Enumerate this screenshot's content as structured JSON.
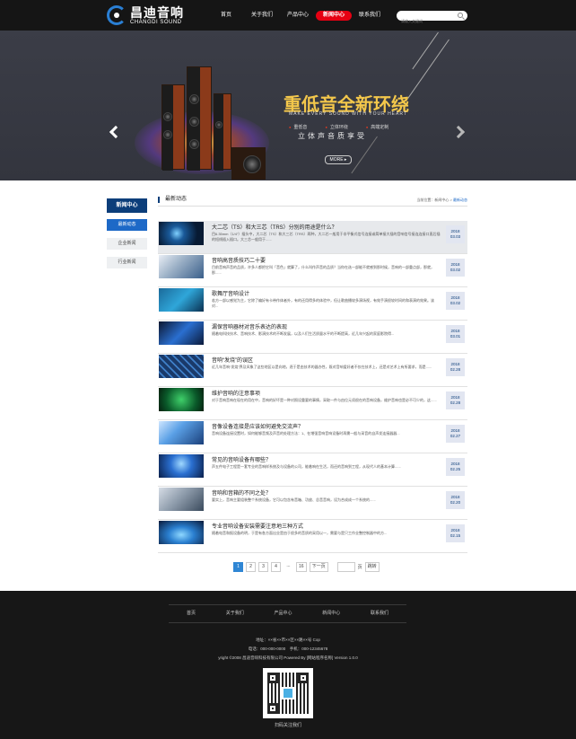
{
  "header": {
    "logo_cn": "昌迪音响",
    "logo_en": "CHANGDI SOUND",
    "nav": [
      "首页",
      "关于我们",
      "产品中心",
      "新闻中心",
      "联系我们"
    ],
    "active_nav": "新闻中心",
    "search_placeholder": "请输入关键词"
  },
  "banner": {
    "slogan": "重低音全新环绕",
    "slogan_en": "MAKE EVERY SOUND WITH YOUR HEART",
    "features": [
      "重低音",
      "立体环绕",
      "高端定制"
    ],
    "subline": "立体声音质享受",
    "more": "MORE"
  },
  "sidebar": {
    "title": "新闻中心",
    "items": [
      "最新动态",
      "企业新闻",
      "行业新闻"
    ]
  },
  "main": {
    "title": "最新动态",
    "breadcrumb": "当前位置：新闻中心 >",
    "breadcrumb_current": "最新动态"
  },
  "news": [
    {
      "title": "大二芯（TS）和大三芯（TRS）分别的用途是什么？",
      "desc": "目6.35mm（1/4″）插头中，大二芯（TS）和大三芯（TRS）两种，大二芯一般用于非平衡式信号连接或简单接大插的音响信号接连连接口直后插的短线插入插口。大三芯一般用于......",
      "year": "2018",
      "date": "03.03"
    },
    {
      "title": "音响高音质技巧二十要",
      "desc": "目前音响声音的品质，许多人都把它叫「音色」就算了，什么叫作声音的品质？当你在选一部能不就感到那时候，音响的一部重点部，那就，那......",
      "year": "2018",
      "date": "03.02"
    },
    {
      "title": "歌舞厅音响设计",
      "desc": "若方一部以感觉为主，它除了编好有卡带作体者外，有的还用得多的体验中，但让歌曲播较多演场视，有效手演很较时间的和表演的效果。该对...",
      "year": "2018",
      "date": "03.02"
    },
    {
      "title": "漏保音响器材对音乐表达的表现",
      "desc": "随着电科技技术、音响技术、影演技术的不断发展，以及人们生活质量水平的不断提高，近几年兴起的家庭影院得...",
      "year": "2018",
      "date": "03.01"
    },
    {
      "title": "音响“发烧”的误区",
      "desc": "近几年音响“发烧”界及风象了这些地区以是向地，逐于是由技术的器办性，既对音响爱好者不仅在技术上，还是对艺术上有所要求，而是......",
      "year": "2018",
      "date": "02.28"
    },
    {
      "title": "维护音响的注意事项",
      "desc": "对于音响音响在现在的用在中，音响的好坏是一种对照设重要的事情，采取一件与由位元须很在的音响设备，维护音响也是必不可少的，这......",
      "year": "2018",
      "date": "02.28"
    },
    {
      "title": "音像设备连接是应该如何避免交流声？",
      "desc": "音响设备连接设置时，如何能够音频及声音的处理方法：1、在增强音响音响设备时再需一般与采音的自声发连接器器...",
      "year": "2018",
      "date": "02.27"
    },
    {
      "title": "常见的音响设备有哪些？",
      "desc": "声五件电子工程是一套专业的音响样系统及与设备的公司，能着响在生活，而还的音响到工程，从现代人的基本计算......",
      "year": "2018",
      "date": "02.25"
    },
    {
      "title": "音响和音箱的不同之处？",
      "desc": "要实上，音响主要组装整个系统设备，它可以包含有音箱、功放、总音音响，设为合成成一个系统的......",
      "year": "2018",
      "date": "02.20"
    },
    {
      "title": "专业音响设备安装需要注意地三种方式",
      "desc": "随着电音和报设备的明，于是有各方面出业是由于很多的音质的采用以一，需要与是只工作业整控制器中的方...",
      "year": "2018",
      "date": "02.15"
    }
  ],
  "pagination": {
    "pages": [
      "1",
      "2",
      "3",
      "4",
      "...",
      "16",
      "下一页"
    ],
    "active": "1",
    "page_label": "页",
    "jump": "跳转"
  },
  "footer": {
    "nav": [
      "首页",
      "关于我们",
      "产品中心",
      "新闻中心",
      "联系我们"
    ],
    "address": "地址：××省××市××区××路××号 Cop",
    "phone": "电话：000-000-0000　手机：000-12345678",
    "copyright": "yright ©2008 昌迪音响科技有限公司 Powered By [网站程序名称] Version 1.0.0",
    "qr_label": "扫码关注我们"
  },
  "colors": {
    "header_bg": "#151515",
    "accent_red": "#e60012",
    "brand_blue": "#0c3e7a",
    "link_blue": "#1d69c7",
    "slogan_gold": "#f3c74b"
  }
}
